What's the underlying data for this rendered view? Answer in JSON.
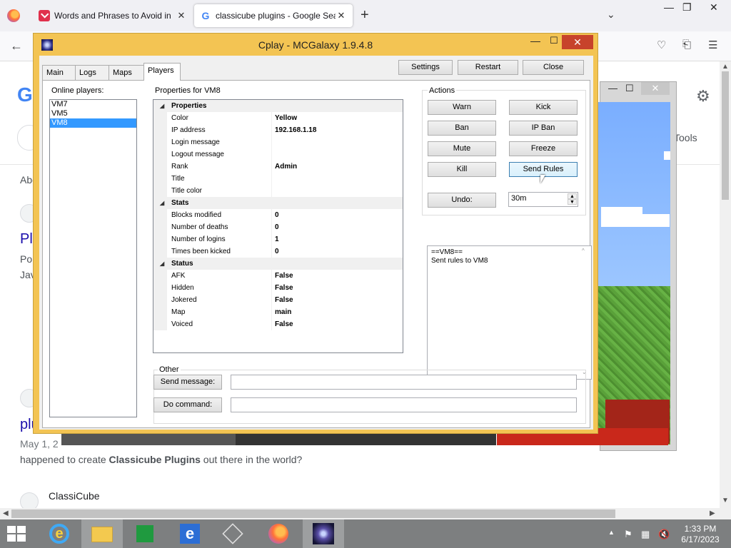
{
  "browser": {
    "tabs": [
      {
        "title": "Words and Phrases to Avoid in",
        "close": "✕"
      },
      {
        "title": "classicube plugins - Google Sea",
        "close": "✕"
      }
    ],
    "new_tab": "+",
    "page": {
      "tools_text": "Tools",
      "abo_text": "Abo",
      "pl_link": "Pl",
      "por_text": "Por",
      "jav_text": "Jav",
      "plu_link": "plu",
      "may_text": "May 1, 2",
      "snippet_prefix": "happened to create ",
      "snippet_bold": "Classicube Plugins",
      "snippet_suffix": " out there in the world?",
      "classicube_result": "ClassiCube"
    }
  },
  "cplay": {
    "title": "Cplay - MCGalaxy 1.9.4.8",
    "tabs": [
      "Main",
      "Logs",
      "Maps",
      "Players"
    ],
    "active_tab": "Players",
    "top_buttons": {
      "settings": "Settings",
      "restart": "Restart",
      "close": "Close"
    },
    "online_players_label": "Online players:",
    "players": [
      "VM7",
      "VM5",
      "VM8"
    ],
    "selected_player": "VM8",
    "properties_label": "Properties for VM8",
    "property_grid": [
      {
        "category": "Properties",
        "rows": [
          {
            "name": "Color",
            "value": "Yellow"
          },
          {
            "name": "IP address",
            "value": "192.168.1.18"
          },
          {
            "name": "Login message",
            "value": ""
          },
          {
            "name": "Logout message",
            "value": ""
          },
          {
            "name": "Rank",
            "value": "Admin"
          },
          {
            "name": "Title",
            "value": ""
          },
          {
            "name": "Title color",
            "value": ""
          }
        ]
      },
      {
        "category": "Stats",
        "rows": [
          {
            "name": "Blocks modified",
            "value": "0"
          },
          {
            "name": "Number of deaths",
            "value": "0"
          },
          {
            "name": "Number of logins",
            "value": "1"
          },
          {
            "name": "Times been kicked",
            "value": "0"
          }
        ]
      },
      {
        "category": "Status",
        "rows": [
          {
            "name": "AFK",
            "value": "False"
          },
          {
            "name": "Hidden",
            "value": "False"
          },
          {
            "name": "Jokered",
            "value": "False"
          },
          {
            "name": "Map",
            "value": "main"
          },
          {
            "name": "Voiced",
            "value": "False"
          }
        ]
      }
    ],
    "actions_label": "Actions",
    "actions": {
      "warn": "Warn",
      "kick": "Kick",
      "ban": "Ban",
      "ip_ban": "IP Ban",
      "mute": "Mute",
      "freeze": "Freeze",
      "kill": "Kill",
      "send_rules": "Send Rules",
      "undo": "Undo:",
      "undo_value": "30m"
    },
    "output_lines": [
      "==VM8==",
      "Sent rules to VM8"
    ],
    "other_label": "Other",
    "send_message_button": "Send message:",
    "send_message_value": "",
    "do_command_button": "Do command:",
    "do_command_value": ""
  },
  "taskbar": {
    "time": "1:33 PM",
    "date": "6/17/2023"
  },
  "colors": {
    "window_frame": "#f3c453",
    "close_button": "#c7432b",
    "selection": "#3399ff",
    "taskbar": "#7d7f80"
  }
}
